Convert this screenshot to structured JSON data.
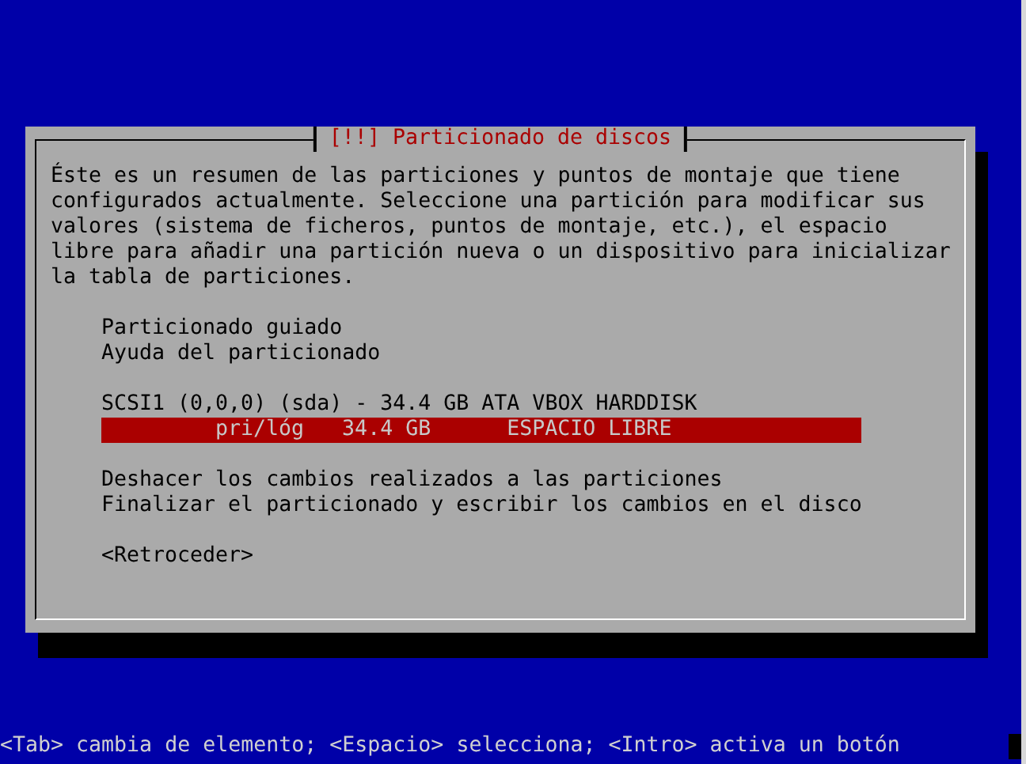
{
  "dialog": {
    "title": "[!!] Particionado de discos",
    "description": "Éste es un resumen de las particiones y puntos de montaje que tiene configurados actualmente. Seleccione una partición para modificar sus valores (sistema de ficheros, puntos de montaje, etc.), el espacio libre para añadir una partición nueva o un dispositivo para inicializar la tabla de particiones.",
    "items": [
      {
        "kind": "option",
        "label": "Particionado guiado",
        "selected": false
      },
      {
        "kind": "option",
        "label": "Ayuda del particionado",
        "selected": false
      },
      {
        "kind": "gap"
      },
      {
        "kind": "disk",
        "label": "SCSI1 (0,0,0) (sda) - 34.4 GB ATA VBOX HARDDISK",
        "selected": false
      },
      {
        "kind": "partition",
        "label": "pri/lóg   34.4 GB      ESPACIO LIBRE",
        "selected": true
      },
      {
        "kind": "gap"
      },
      {
        "kind": "option",
        "label": "Deshacer los cambios realizados a las particiones",
        "selected": false
      },
      {
        "kind": "option",
        "label": "Finalizar el particionado y escribir los cambios en el disco",
        "selected": false
      },
      {
        "kind": "gap"
      },
      {
        "kind": "button",
        "label": "<Retroceder>",
        "selected": false
      }
    ]
  },
  "status_bar": "<Tab> cambia de elemento; <Espacio> selecciona; <Intro> activa un botón"
}
